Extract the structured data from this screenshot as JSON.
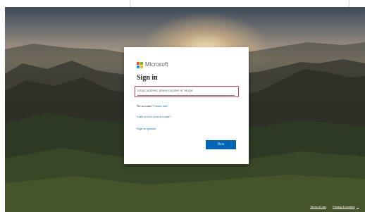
{
  "brand": {
    "name": "Microsoft",
    "colors": {
      "red": "#f25022",
      "green": "#7fba00",
      "blue": "#00a4ef",
      "yellow": "#ffb900"
    }
  },
  "signin": {
    "title": "Sign in",
    "email_placeholder": "Email address, phone number or Skype",
    "email_value": "",
    "no_account_prefix": "No account?",
    "create_one": "Create one!",
    "cant_access": "Can't access your account?",
    "signin_options": "Sign in options",
    "next_button": "Next"
  },
  "footer": {
    "terms": "Terms of use",
    "privacy": "Privacy & cookies",
    "more": "..."
  },
  "theme": {
    "accent": "#0067b8",
    "focus_border": "#d43b54"
  }
}
